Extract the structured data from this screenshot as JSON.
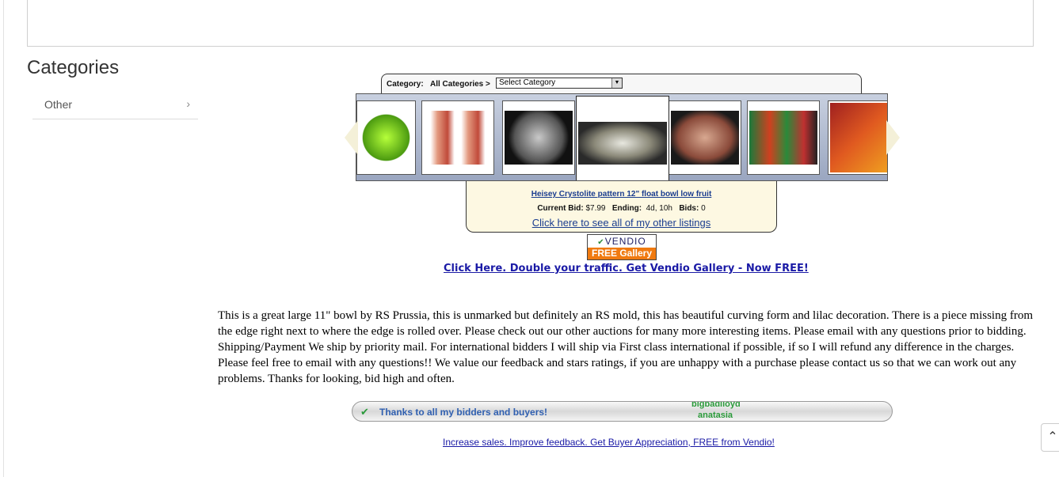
{
  "sidebar": {
    "heading": "Categories",
    "items": [
      {
        "label": "Other"
      }
    ]
  },
  "gallery": {
    "category_label": "Category:",
    "category_value": "All Categories >",
    "select_value": "Select Category",
    "featured_item": {
      "title": "Heisey Crystolite pattern 12\" float bowl low fruit",
      "bid_label": "Current Bid:",
      "bid_value": "$7.99",
      "ending_label": "Ending:",
      "ending_value": "4d, 10h",
      "bids_label": "Bids:",
      "bids_value": "0"
    },
    "see_all_link": "Click here to see all of my other listings",
    "thumbnails": [
      {
        "name": "green-glass-dish"
      },
      {
        "name": "cranberry-shakers"
      },
      {
        "name": "etched-glass-bowl"
      },
      {
        "name": "crystolite-bowl"
      },
      {
        "name": "pink-glass-tray"
      },
      {
        "name": "crackle-glass-books"
      },
      {
        "name": "crackle-glass-book"
      }
    ]
  },
  "vendio_badge": {
    "brand": "VENDIO",
    "free_label": "FREE Gallery"
  },
  "promo_link": "Click Here. Double your traffic. Get Vendio Gallery - Now FREE!",
  "description": "This is a great large 11\" bowl by RS Prussia, this is unmarked but definitely an RS mold, this has beautiful curving form and lilac decoration. There is a piece missing from the edge right next to where the edge is rolled over. Please check out our other auctions for many more interesting items. Please email with any questions prior to bidding. Shipping/Payment We ship by priority mail. For international bidders I will ship via First class international if possible, if so I will refund any difference in the charges. Please feel free to email with any questions!! We value our feedback and stars ratings, if you are unhappy with a purchase please contact us so that we can work out any problems. Thanks for looking, bid high and often.",
  "thanks_bar": {
    "text": "Thanks to all my bidders and buyers!",
    "names": [
      "bigbadlloyd",
      "anatasia"
    ]
  },
  "appreciation_link": "Increase sales. Improve feedback. Get Buyer Appreciation, FREE from Vendio!",
  "scroll_top_icon": "chevron-up-icon"
}
